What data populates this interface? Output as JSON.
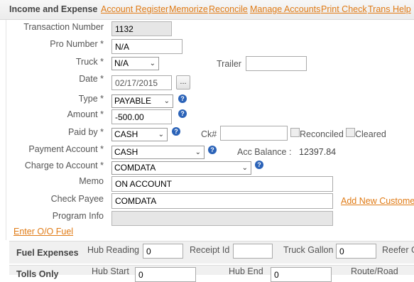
{
  "header": {
    "title": "Income and Expense",
    "links": [
      "Account Register",
      "Memorize",
      "Reconcile",
      "Manage Accounts",
      "Print Check",
      "Trans Help"
    ]
  },
  "form": {
    "transaction_number": {
      "label": "Transaction Number",
      "value": "1132"
    },
    "pro_number": {
      "label": "Pro Number *",
      "value": "N/A"
    },
    "truck": {
      "label": "Truck *",
      "value": "N/A"
    },
    "trailer": {
      "label": "Trailer",
      "value": ""
    },
    "date": {
      "label": "Date *",
      "value": "02/17/2015",
      "picker": "..."
    },
    "type": {
      "label": "Type *",
      "value": "PAYABLE"
    },
    "amount": {
      "label": "Amount *",
      "value": "-500.00"
    },
    "paid_by": {
      "label": "Paid by *",
      "value": "CASH"
    },
    "ck_no": {
      "label": "Ck#",
      "value": ""
    },
    "reconciled": {
      "label": "Reconciled"
    },
    "cleared": {
      "label": "Cleared"
    },
    "payment_account": {
      "label": "Payment Account *",
      "value": "CASH"
    },
    "acc_balance": {
      "label": "Acc Balance :",
      "value": "12397.84"
    },
    "charge_to_account": {
      "label": "Charge to Account *",
      "value": "COMDATA"
    },
    "memo": {
      "label": "Memo",
      "value": "ON ACCOUNT"
    },
    "check_payee": {
      "label": "Check Payee",
      "value": "COMDATA"
    },
    "add_new_customer": "Add New Customer",
    "program_info": {
      "label": "Program Info",
      "value": ""
    },
    "enter_oo_fuel": "Enter O/O Fuel",
    "help_glyph": "?"
  },
  "fuel": {
    "title": "Fuel Expenses",
    "hub_reading": {
      "label": "Hub Reading",
      "value": "0"
    },
    "receipt_id": {
      "label": "Receipt Id",
      "value": ""
    },
    "truck_gallon": {
      "label": "Truck Gallon",
      "value": "0"
    },
    "reefer": {
      "label": "Reefer G"
    }
  },
  "tolls": {
    "title": "Tolls Only",
    "hub_start": {
      "label": "Hub Start",
      "value": "0"
    },
    "hub_end": {
      "label": "Hub End",
      "value": "0"
    },
    "route_road": {
      "label": "Route/Road"
    }
  },
  "icons": {
    "help": "help-circle-icon",
    "dropdown": "chevron-down-icon"
  },
  "colors": {
    "link": "#e07b16",
    "help": "#2b63b8"
  }
}
